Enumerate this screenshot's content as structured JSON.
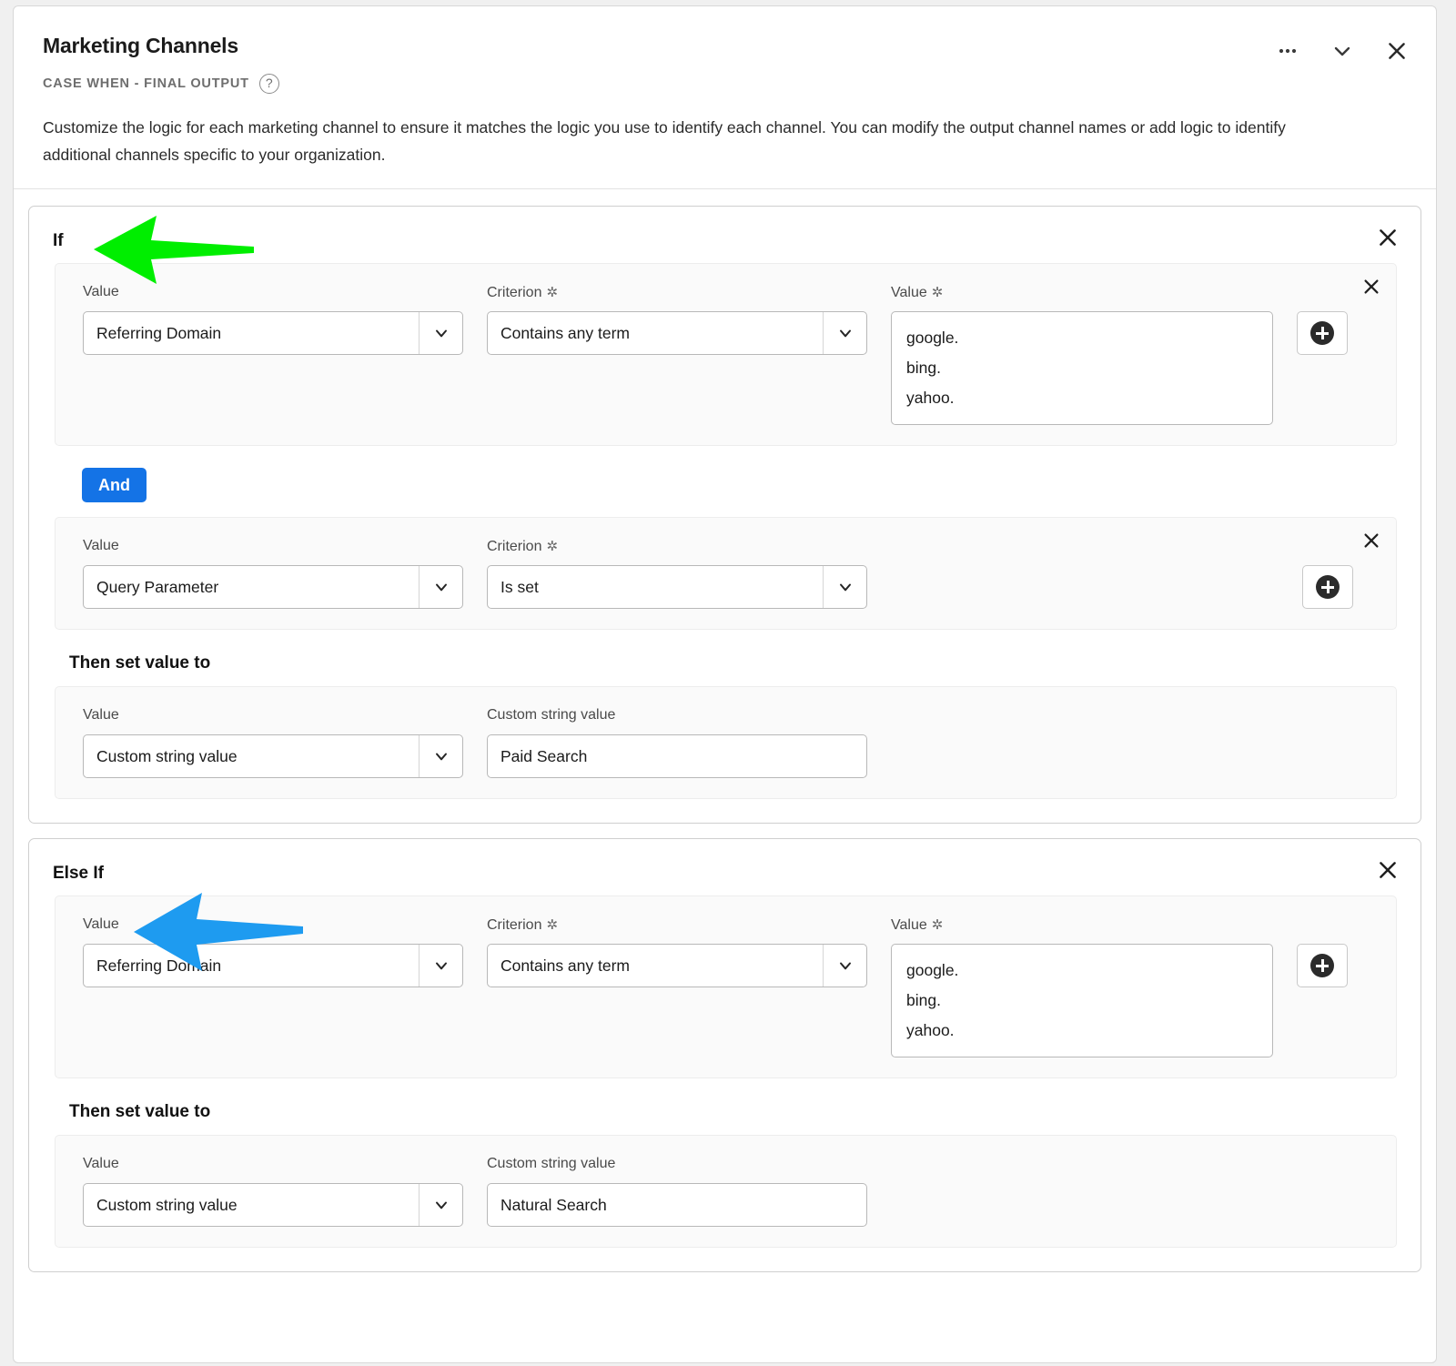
{
  "dialog": {
    "title": "Marketing Channels",
    "subtitle": "CASE WHEN - FINAL OUTPUT",
    "help_icon": "help-circle-icon",
    "description": "Customize the logic for each marketing channel to ensure it matches the logic you use to identify each channel. You can modify the output channel names or add logic to identify additional channels specific to your organization.",
    "actions": [
      {
        "name": "more-options",
        "icon": "ellipsis-icon"
      },
      {
        "name": "collapse",
        "icon": "chevron-down-icon"
      },
      {
        "name": "close",
        "icon": "close-icon"
      }
    ]
  },
  "labels": {
    "value": "Value",
    "criterion": "Criterion",
    "required_mark": "✲",
    "custom_string_value": "Custom string value",
    "then_set_value_to": "Then set value to",
    "add": "add-button",
    "close": "close-button",
    "drag": "drag-handle"
  },
  "branches": [
    {
      "label": "If",
      "conditions": [
        {
          "value_select": "Referring Domain",
          "criterion_select": "Contains any term",
          "value_textarea": "google.\nbing.\nyahoo.",
          "has_value_field": true,
          "has_add_button": true
        },
        {
          "value_select": "Query Parameter",
          "criterion_select": "Is set",
          "value_textarea": "",
          "has_value_field": false,
          "has_add_button": true
        }
      ],
      "operator": "And",
      "then": {
        "value_select": "Custom string value",
        "custom_string_value": "Paid Search"
      }
    },
    {
      "label": "Else If",
      "conditions": [
        {
          "value_select": "Referring Domain",
          "criterion_select": "Contains any term",
          "value_textarea": "google.\nbing.\nyahoo.",
          "has_value_field": true,
          "has_add_button": true
        }
      ],
      "operator": null,
      "then": {
        "value_select": "Custom string value",
        "custom_string_value": "Natural Search"
      }
    }
  ],
  "annotations": [
    {
      "name": "green-arrow-pointing-at-if",
      "color": "#00ee00",
      "direction": "left"
    },
    {
      "name": "blue-arrow-pointing-at-else-if",
      "color": "#1e9bf0",
      "direction": "left"
    }
  ]
}
